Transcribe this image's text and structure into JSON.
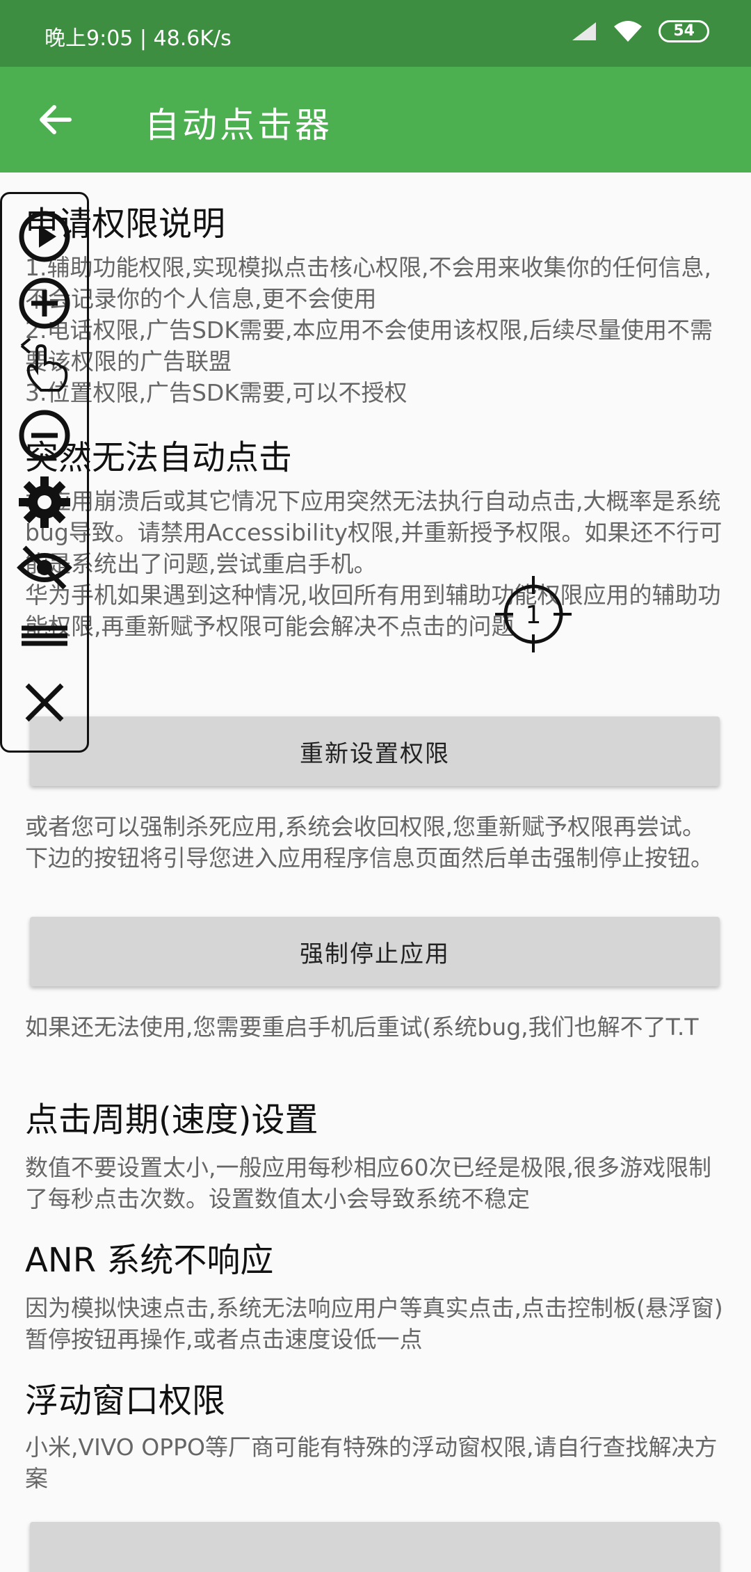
{
  "status_bar": {
    "time": "晚上9:05 | 48.6K/s",
    "battery": "54"
  },
  "toolbar": {
    "title": "自动点击器"
  },
  "sections": {
    "permission_title": "申请权限说明",
    "permission_body": "1.辅助功能权限,实现模拟点击核心权限,不会用来收集你的任何信息,不会记录你的个人信息,更不会使用\n2.电话权限,广告SDK需要,本应用不会使用该权限,后续尽量使用不需要该权限的广告联盟\n3.位置权限,广告SDK需要,可以不授权",
    "auto_click_title": "突然无法自动点击",
    "auto_click_body": "本应用崩溃后或其它情况下应用突然无法执行自动点击,大概率是系统bug导致。请禁用Accessibility权限,并重新授予权限。如果还不行可能是系统出了问题,尝试重启手机。\n华为手机如果遇到这种情况,收回所有用到辅助功能权限应用的辅助功能权限,再重新赋予权限可能会解决不点击的问题",
    "reset_button": "重新设置权限",
    "force_stop_text": "或者您可以强制杀死应用,系统会收回权限,您重新赋予权限再尝试。下边的按钮将引导您进入应用程序信息页面然后单击强制停止按钮。",
    "force_stop_button": "强制停止应用",
    "restart_text": "如果还无法使用,您需要重启手机后重试(系统bug,我们也解不了T.T",
    "period_title": "点击周期(速度)设置",
    "period_body": "数值不要设置太小,一般应用每秒相应60次已经是极限,很多游戏限制了每秒点击次数。设置数值太小会导致系统不稳定",
    "anr_title": "ANR 系统不响应",
    "anr_body": "因为模拟快速点击,系统无法响应用户等真实点击,点击控制板(悬浮窗)暂停按钮再操作,或者点击速度设低一点",
    "float_title": "浮动窗口权限",
    "float_body": "小米,VIVO OPPO等厂商可能有特殊的浮动窗权限,请自行查找解决方案"
  },
  "crosshair_label": "1"
}
